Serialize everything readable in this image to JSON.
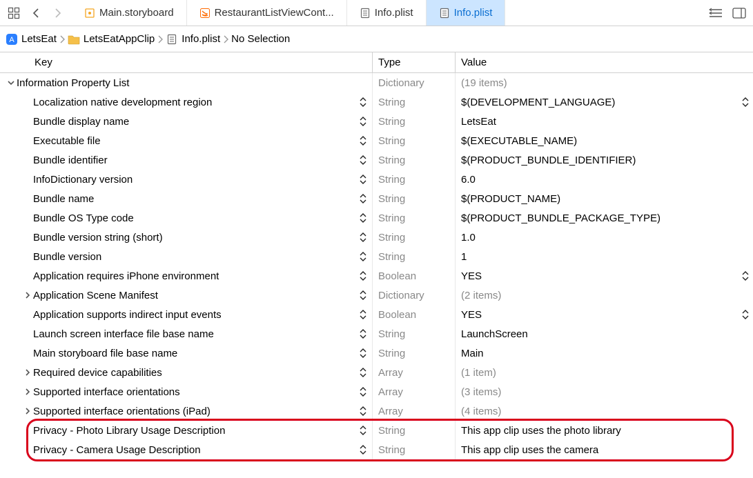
{
  "tabbar": {
    "tabs": [
      {
        "label": "Main.storyboard",
        "active": false,
        "iconColor": "#f5a623",
        "iconType": "storyboard"
      },
      {
        "label": "RestaurantListViewCont...",
        "active": false,
        "iconColor": "#ff6a00",
        "iconType": "swift"
      },
      {
        "label": "Info.plist",
        "active": false,
        "iconColor": "#6a6a6a",
        "iconType": "plist"
      },
      {
        "label": "Info.plist",
        "active": true,
        "iconColor": "#6a6a6a",
        "iconType": "plist"
      }
    ]
  },
  "breadcrumb": {
    "items": [
      {
        "label": "LetsEat",
        "iconType": "app"
      },
      {
        "label": "LetsEatAppClip",
        "iconType": "folder"
      },
      {
        "label": "Info.plist",
        "iconType": "plist"
      },
      {
        "label": "No Selection",
        "iconType": "none"
      }
    ]
  },
  "columns": {
    "key": "Key",
    "type": "Type",
    "value": "Value"
  },
  "rows": [
    {
      "key": "Information Property List",
      "type": "Dictionary",
      "value": "(19 items)",
      "indent": 0,
      "disclosure": "down",
      "updown": false,
      "greyValue": true,
      "endStepper": false
    },
    {
      "key": "Localization native development region",
      "type": "String",
      "value": "$(DEVELOPMENT_LANGUAGE)",
      "indent": 1,
      "disclosure": "",
      "updown": true,
      "greyValue": false,
      "endStepper": true
    },
    {
      "key": "Bundle display name",
      "type": "String",
      "value": "LetsEat",
      "indent": 1,
      "disclosure": "",
      "updown": true,
      "greyValue": false,
      "endStepper": false
    },
    {
      "key": "Executable file",
      "type": "String",
      "value": "$(EXECUTABLE_NAME)",
      "indent": 1,
      "disclosure": "",
      "updown": true,
      "greyValue": false,
      "endStepper": false
    },
    {
      "key": "Bundle identifier",
      "type": "String",
      "value": "$(PRODUCT_BUNDLE_IDENTIFIER)",
      "indent": 1,
      "disclosure": "",
      "updown": true,
      "greyValue": false,
      "endStepper": false
    },
    {
      "key": "InfoDictionary version",
      "type": "String",
      "value": "6.0",
      "indent": 1,
      "disclosure": "",
      "updown": true,
      "greyValue": false,
      "endStepper": false
    },
    {
      "key": "Bundle name",
      "type": "String",
      "value": "$(PRODUCT_NAME)",
      "indent": 1,
      "disclosure": "",
      "updown": true,
      "greyValue": false,
      "endStepper": false
    },
    {
      "key": "Bundle OS Type code",
      "type": "String",
      "value": "$(PRODUCT_BUNDLE_PACKAGE_TYPE)",
      "indent": 1,
      "disclosure": "",
      "updown": true,
      "greyValue": false,
      "endStepper": false
    },
    {
      "key": "Bundle version string (short)",
      "type": "String",
      "value": "1.0",
      "indent": 1,
      "disclosure": "",
      "updown": true,
      "greyValue": false,
      "endStepper": false
    },
    {
      "key": "Bundle version",
      "type": "String",
      "value": "1",
      "indent": 1,
      "disclosure": "",
      "updown": true,
      "greyValue": false,
      "endStepper": false
    },
    {
      "key": "Application requires iPhone environment",
      "type": "Boolean",
      "value": "YES",
      "indent": 1,
      "disclosure": "",
      "updown": true,
      "greyValue": false,
      "endStepper": true
    },
    {
      "key": "Application Scene Manifest",
      "type": "Dictionary",
      "value": "(2 items)",
      "indent": 1,
      "disclosure": "right",
      "updown": true,
      "greyValue": true,
      "endStepper": false
    },
    {
      "key": "Application supports indirect input events",
      "type": "Boolean",
      "value": "YES",
      "indent": 1,
      "disclosure": "",
      "updown": true,
      "greyValue": false,
      "endStepper": true
    },
    {
      "key": "Launch screen interface file base name",
      "type": "String",
      "value": "LaunchScreen",
      "indent": 1,
      "disclosure": "",
      "updown": true,
      "greyValue": false,
      "endStepper": false
    },
    {
      "key": "Main storyboard file base name",
      "type": "String",
      "value": "Main",
      "indent": 1,
      "disclosure": "",
      "updown": true,
      "greyValue": false,
      "endStepper": false
    },
    {
      "key": "Required device capabilities",
      "type": "Array",
      "value": "(1 item)",
      "indent": 1,
      "disclosure": "right",
      "updown": true,
      "greyValue": true,
      "endStepper": false
    },
    {
      "key": "Supported interface orientations",
      "type": "Array",
      "value": "(3 items)",
      "indent": 1,
      "disclosure": "right",
      "updown": true,
      "greyValue": true,
      "endStepper": false
    },
    {
      "key": "Supported interface orientations (iPad)",
      "type": "Array",
      "value": "(4 items)",
      "indent": 1,
      "disclosure": "right",
      "updown": true,
      "greyValue": true,
      "endStepper": false
    },
    {
      "key": "Privacy - Photo Library Usage Description",
      "type": "String",
      "value": "This app clip uses the photo library",
      "indent": 1,
      "disclosure": "",
      "updown": true,
      "greyValue": false,
      "endStepper": false
    },
    {
      "key": "Privacy - Camera Usage Description",
      "type": "String",
      "value": "This app clip uses the camera",
      "indent": 1,
      "disclosure": "",
      "updown": true,
      "greyValue": false,
      "endStepper": false
    }
  ],
  "highlight": {
    "fromRow": 18,
    "toRow": 19
  }
}
